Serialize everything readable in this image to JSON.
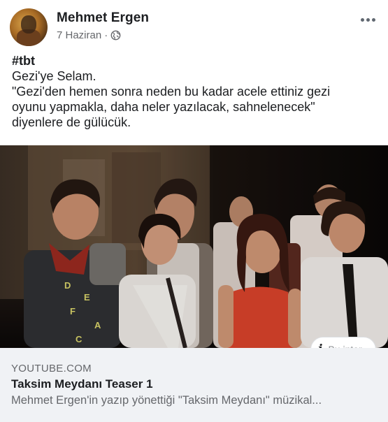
{
  "post": {
    "author": "Mehmet Ergen",
    "date": "7 Haziran",
    "date_separator": "·",
    "privacy_icon": "globe-icon",
    "more_icon": "ellipsis-icon",
    "hashtag": "#tbt",
    "lines": [
      "Gezi'ye Selam.",
      "\"Gezi'den hemen sonra neden bu kadar acele ettiniz gezi",
      "oyunu yapmakla, daha neler yazılacak, sahnelenecek\"",
      "diyenlere de gülücük."
    ]
  },
  "media": {
    "info_label": "Bu inter",
    "info_icon": "info-icon"
  },
  "link_preview": {
    "domain": "YOUTUBE.COM",
    "title": "Taksim Meydanı Teaser 1",
    "description": "Mehmet Ergen'in yazıp yönettiği \"Taksim Meydanı\" müzikal..."
  },
  "colors": {
    "text": "#1c1e21",
    "secondary": "#65676b",
    "preview_bg": "#f0f2f5"
  }
}
